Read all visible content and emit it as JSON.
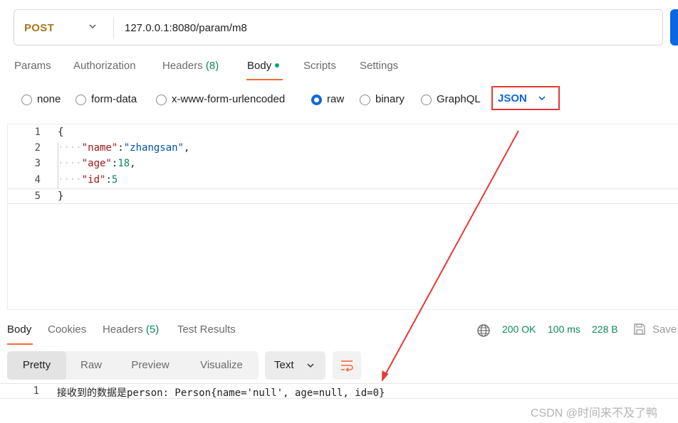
{
  "request": {
    "method": "POST",
    "url": "127.0.0.1:8080/param/m8"
  },
  "request_tabs": [
    {
      "label": "Params"
    },
    {
      "label": "Authorization"
    },
    {
      "label": "Headers",
      "count": "(8)"
    },
    {
      "label": "Body",
      "active": true
    },
    {
      "label": "Scripts"
    },
    {
      "label": "Settings"
    }
  ],
  "body_types": {
    "options": [
      "none",
      "form-data",
      "x-www-form-urlencoded",
      "raw",
      "binary",
      "GraphQL"
    ],
    "selected": "raw",
    "format": "JSON"
  },
  "editor_lines": [
    {
      "n": "1"
    },
    {
      "n": "2",
      "key": "\"name\"",
      "value": "\"zhangsan\"",
      "trail": ","
    },
    {
      "n": "3",
      "key": "\"age\"",
      "value": "18",
      "trail": ","
    },
    {
      "n": "4",
      "key": "\"id\"",
      "value": "5",
      "trail": ""
    },
    {
      "n": "5"
    }
  ],
  "editor_text": {
    "open_brace": "{",
    "close_brace": "}",
    "indent": "····",
    "colon": ":"
  },
  "response_tabs": [
    {
      "label": "Body",
      "active": true
    },
    {
      "label": "Cookies"
    },
    {
      "label": "Headers",
      "count": "(5)"
    },
    {
      "label": "Test Results"
    }
  ],
  "response_status": {
    "status": "200 OK",
    "time": "100 ms",
    "size": "228 B",
    "save_label": "Save"
  },
  "view_modes": {
    "options": [
      "Pretty",
      "Raw",
      "Preview",
      "Visualize"
    ],
    "selected": "Pretty",
    "format": "Text"
  },
  "response_body": {
    "line_number": "1",
    "text": "接收到的数据是person: Person{name='null', age=null, id=0}"
  },
  "watermark": "CSDN @时间来不及了鸭",
  "colors": {
    "accent": "#f26b3a",
    "brand_blue": "#0c66e4",
    "method": "#a8771b",
    "status_green": "#0d8a57",
    "annotation_red": "#e53935"
  },
  "icons": [
    "chevron-down-icon",
    "globe-icon",
    "save-icon",
    "wrap-lines-icon"
  ]
}
